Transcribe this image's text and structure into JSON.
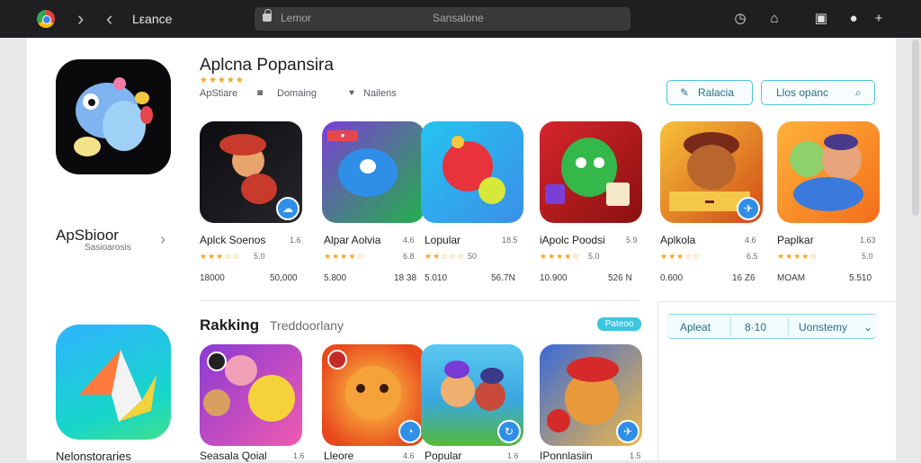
{
  "topbar": {
    "title": "Lεance",
    "address_left": "Lemor",
    "address_center": "Sansalone"
  },
  "sidebar": {
    "app_name": "ApSbioor",
    "app_sub": "Sasioarosis",
    "bottom_label": "Nelonstoraries"
  },
  "header": {
    "title": "Aplcna Popansira",
    "stars": "★★★★★",
    "meta": [
      {
        "icon": "store-icon",
        "text": "ApStiare"
      },
      {
        "icon": "camera-icon",
        "text": "Domaing"
      },
      {
        "icon": "heart-icon",
        "text": "Nailens"
      }
    ],
    "action_button": "Ralacia",
    "search_placeholder": "Llos opanc"
  },
  "row1": [
    {
      "name": "Aplck Soenos",
      "num": "1.6",
      "stars": "★★★☆☆",
      "rating": "5.0",
      "dl1": "18000",
      "dl2": "50,000"
    },
    {
      "name": "Alpar Aolvia",
      "num": "4.6",
      "stars": "★★★★☆",
      "rating": "6.8",
      "dl1": "5.800",
      "dl2": "18 38"
    },
    {
      "name": "Lopular",
      "num": "18.5",
      "stars": "★★☆☆☆",
      "rating": "50",
      "dl1": "5.010",
      "dl2": "56.7N"
    },
    {
      "name": "iApolc Poodsi",
      "num": "5.9",
      "stars": "★★★★☆",
      "rating": "5.0",
      "dl1": "10.900",
      "dl2": "526 N"
    },
    {
      "name": "Aplkola",
      "num": "4.6",
      "stars": "★★★☆☆",
      "rating": "6.5",
      "dl1": "0.600",
      "dl2": "16 Z6"
    },
    {
      "name": "Paplkar",
      "num": "1.63",
      "stars": "★★★★☆",
      "rating": "5.0",
      "dl1": "MOAM",
      "dl2": "5.510"
    }
  ],
  "ranking": {
    "title": "Rakking",
    "subtitle": "Treddoorlany",
    "pill": "Pateoo"
  },
  "row2": [
    {
      "name": "Seasala Qoial",
      "num": "1.6"
    },
    {
      "name": "Lleore",
      "num": "4.6"
    },
    {
      "name": "Popular",
      "num": "1.6"
    },
    {
      "name": "IPonnlasiin",
      "num": "1.5"
    }
  ],
  "segment": {
    "left": "Apleat",
    "mid": "8·10",
    "right": "Uonstemy"
  }
}
